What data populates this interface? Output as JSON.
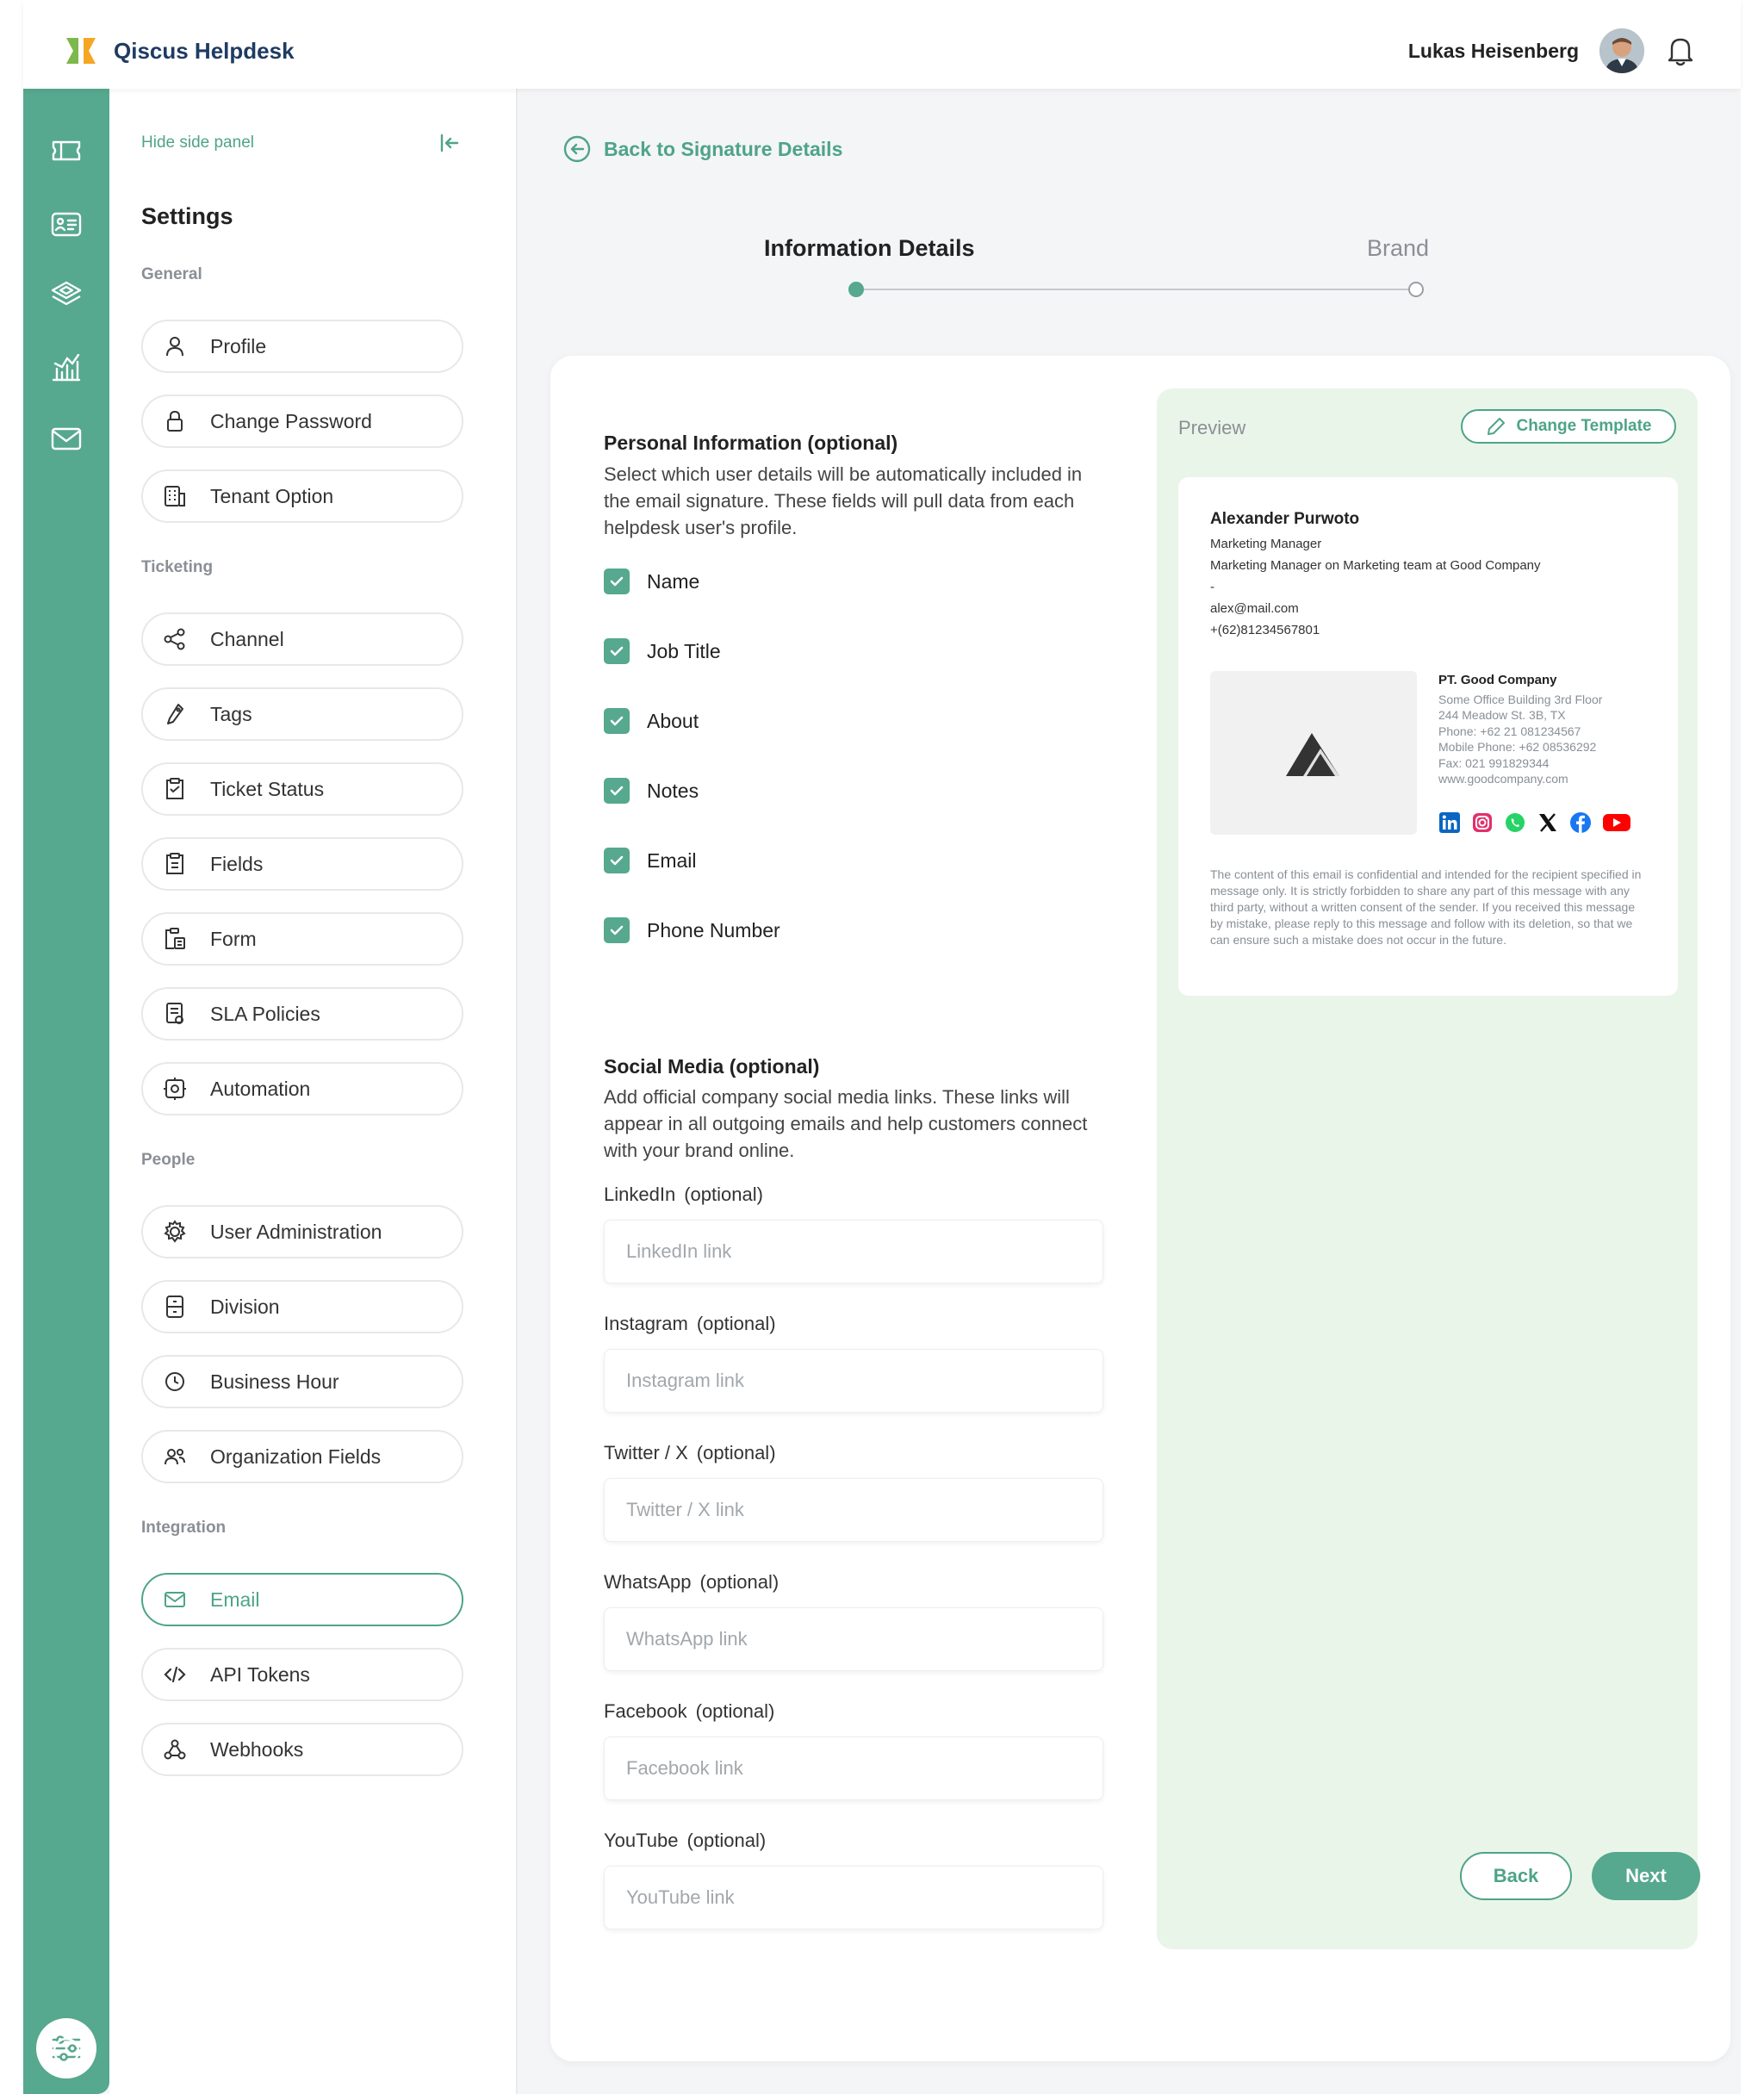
{
  "header": {
    "app_title": "Qiscus Helpdesk",
    "user_name": "Lukas Heisenberg",
    "brand_colors": {
      "primary": "#56a88e",
      "accent": "#4ea487",
      "logo_green": "#7cb84a",
      "logo_orange": "#f5a623",
      "title": "#1f3b63"
    }
  },
  "rail": {
    "icons": [
      "ticket-icon",
      "contact-card-icon",
      "layers-icon",
      "analytics-icon",
      "mail-icon",
      "settings-sliders-icon",
      "power-icon"
    ]
  },
  "side_panel": {
    "hide_label": "Hide side panel",
    "title": "Settings",
    "sections": [
      {
        "label": "General",
        "items": [
          {
            "label": "Profile",
            "icon": "user-icon"
          },
          {
            "label": "Change Password",
            "icon": "lock-icon"
          },
          {
            "label": "Tenant Option",
            "icon": "building-icon"
          }
        ]
      },
      {
        "label": "Ticketing",
        "items": [
          {
            "label": "Channel",
            "icon": "share-nodes-icon"
          },
          {
            "label": "Tags",
            "icon": "tag-icon"
          },
          {
            "label": "Ticket Status",
            "icon": "clipboard-icon"
          },
          {
            "label": "Fields",
            "icon": "clipboard-list-icon"
          },
          {
            "label": "Form",
            "icon": "form-icon"
          },
          {
            "label": "SLA Policies",
            "icon": "document-icon"
          },
          {
            "label": "Automation",
            "icon": "automation-icon"
          }
        ]
      },
      {
        "label": "People",
        "items": [
          {
            "label": "User Administration",
            "icon": "user-gear-icon"
          },
          {
            "label": "Division",
            "icon": "division-icon"
          },
          {
            "label": "Business Hour",
            "icon": "clock-icon"
          },
          {
            "label": "Organization Fields",
            "icon": "users-icon"
          }
        ]
      },
      {
        "label": "Integration",
        "items": [
          {
            "label": "Email",
            "icon": "mail-icon",
            "active": true
          },
          {
            "label": "API Tokens",
            "icon": "code-icon"
          },
          {
            "label": "Webhooks",
            "icon": "webhook-icon"
          }
        ]
      }
    ]
  },
  "main": {
    "back_label": "Back to Signature Details",
    "steps": [
      {
        "label": "Information Details",
        "active": true
      },
      {
        "label": "Brand",
        "active": false
      }
    ],
    "personal": {
      "title": "Personal Information (optional)",
      "description": "Select which user details will be automatically included in the email signature. These fields will pull data from each helpdesk user's profile.",
      "checkboxes": [
        {
          "label": "Name",
          "checked": true
        },
        {
          "label": "Job Title",
          "checked": true
        },
        {
          "label": "About",
          "checked": true
        },
        {
          "label": "Notes",
          "checked": true
        },
        {
          "label": "Email",
          "checked": true
        },
        {
          "label": "Phone Number",
          "checked": true
        }
      ]
    },
    "social": {
      "title": "Social Media (optional)",
      "description": "Add official company social media links. These links will appear in all outgoing emails and help customers connect with your brand online.",
      "fields": [
        {
          "label": "LinkedIn",
          "optional": "(optional)",
          "placeholder": "LinkedIn link",
          "value": ""
        },
        {
          "label": "Instagram",
          "optional": "(optional)",
          "placeholder": "Instagram link",
          "value": ""
        },
        {
          "label": "Twitter / X",
          "optional": "(optional)",
          "placeholder": "Twitter / X link",
          "value": ""
        },
        {
          "label": "WhatsApp",
          "optional": "(optional)",
          "placeholder": "WhatsApp link",
          "value": ""
        },
        {
          "label": "Facebook",
          "optional": "(optional)",
          "placeholder": "Facebook link",
          "value": ""
        },
        {
          "label": "YouTube",
          "optional": "(optional)",
          "placeholder": "YouTube link",
          "value": ""
        }
      ]
    },
    "preview": {
      "label": "Preview",
      "change_template": "Change Template",
      "signature": {
        "name": "Alexander Purwoto",
        "lines": [
          "Marketing Manager",
          "Marketing Manager on Marketing team at Good Company",
          "-",
          "alex@mail.com",
          "+(62)81234567801"
        ],
        "company_name": "PT. Good Company",
        "company_lines": [
          "Some Office Building 3rd Floor",
          "244 Meadow St. 3B, TX",
          "Phone: +62 21 081234567",
          "Mobile Phone: +62 08536292",
          "Fax: 021 991829344",
          "www.goodcompany.com"
        ],
        "social_icons": [
          "linkedin-icon",
          "instagram-icon",
          "whatsapp-icon",
          "x-icon",
          "facebook-icon",
          "youtube-icon"
        ],
        "disclaimer": "The content of this email is confidential and intended for the recipient specified in message only. It is strictly forbidden to share any part of this message with any third party, without a written consent of the sender. If you received this message by mistake, please reply to this message and follow with its deletion, so that we can ensure such a mistake does not occur in the future."
      }
    },
    "buttons": {
      "back": "Back",
      "next": "Next"
    }
  }
}
